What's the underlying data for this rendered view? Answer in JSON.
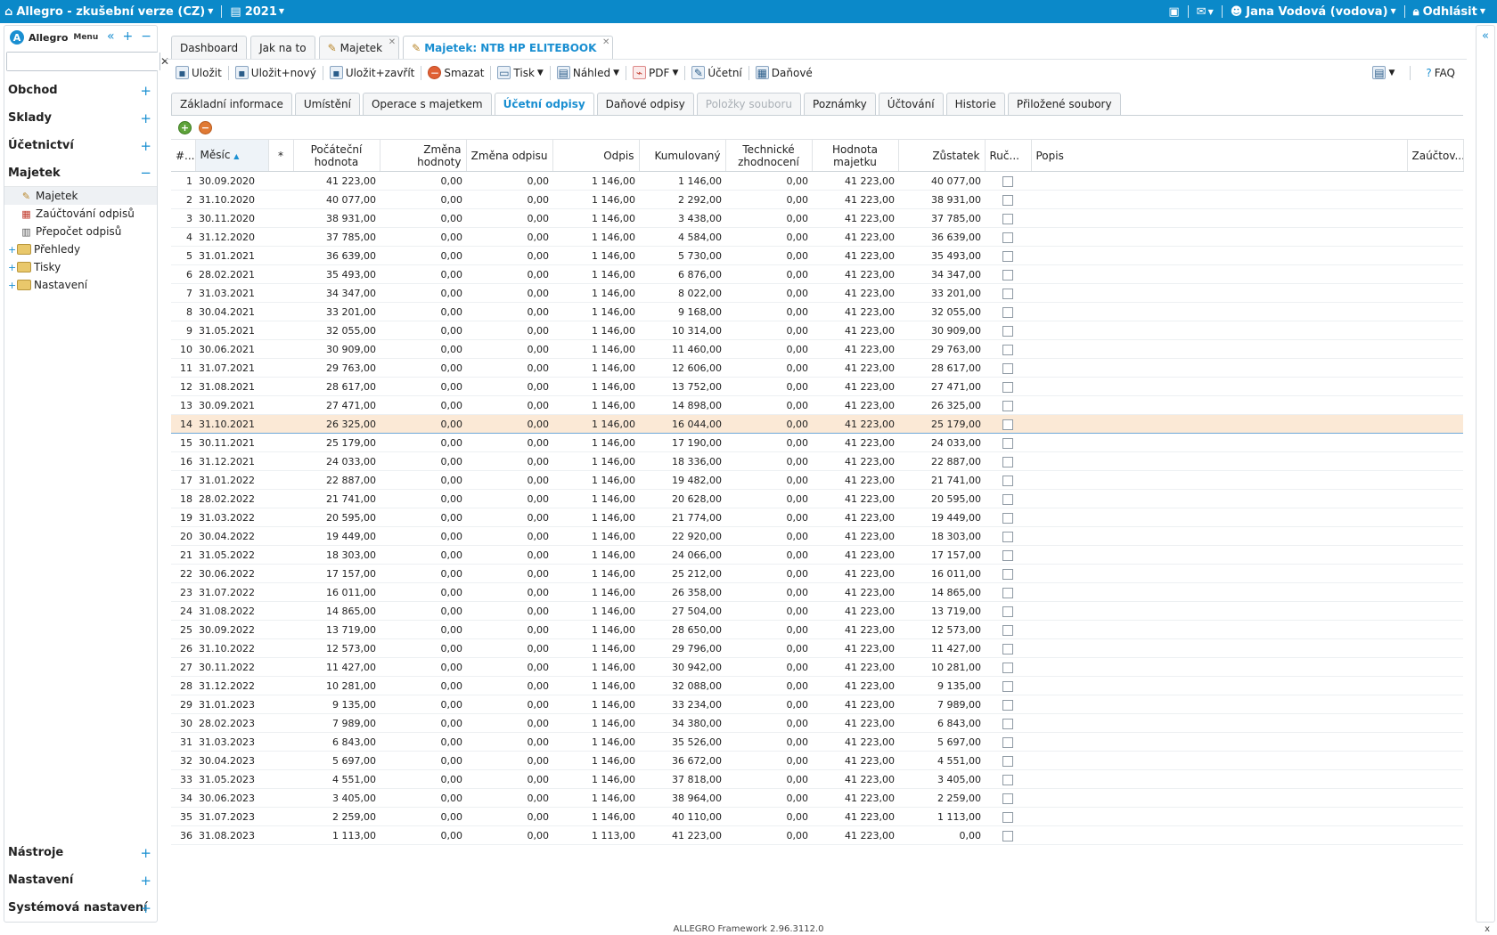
{
  "topbar": {
    "app_title": "Allegro - zkušební verze (CZ)",
    "year": "2021",
    "user": "Jana Vodová (vodova)",
    "logout": "Odhlásit"
  },
  "sidebar": {
    "brand": "Allegro",
    "menu_label": "Menu",
    "search_placeholder": "",
    "sections_top": [
      {
        "label": "Obchod"
      },
      {
        "label": "Sklady"
      },
      {
        "label": "Účetnictví"
      }
    ],
    "open_section": {
      "label": "Majetek",
      "items": [
        "Majetek",
        "Zaúčtování odpisů",
        "Přepočet odpisů"
      ],
      "folders": [
        "Přehledy",
        "Tisky",
        "Nastavení"
      ]
    },
    "sections_bottom": [
      {
        "label": "Nástroje"
      },
      {
        "label": "Nastavení"
      },
      {
        "label": "Systémová nastavení"
      }
    ]
  },
  "doc_tabs": [
    "Dashboard",
    "Jak na to",
    "Majetek",
    "Majetek: NTB HP ELITEBOOK"
  ],
  "toolbar": {
    "save": "Uložit",
    "save_new": "Uložit+nový",
    "save_close": "Uložit+zavřít",
    "delete": "Smazat",
    "print": "Tisk",
    "preview": "Náhled",
    "pdf": "PDF",
    "accounting": "Účetní",
    "tax": "Daňové",
    "faq": "FAQ"
  },
  "sub_tabs": [
    "Základní informace",
    "Umístění",
    "Operace s majetkem",
    "Účetní odpisy",
    "Daňové odpisy",
    "Položky souboru",
    "Poznámky",
    "Účtování",
    "Historie",
    "Přiložené soubory"
  ],
  "grid": {
    "columns": {
      "idx": "#...",
      "month": "Měsíc",
      "star": "*",
      "initial": "Počáteční hodnota",
      "value_change": "Změna hodnoty",
      "dep_change": "Změna odpisu",
      "dep": "Odpis",
      "cumulative": "Kumulovaný",
      "tech": "Technické zhodnocení",
      "asset_value": "Hodnota majetku",
      "residual": "Zůstatek",
      "manual": "Ruč...",
      "desc": "Popis",
      "posting": "Zaúčtov..."
    },
    "selected_row": 14,
    "rows": [
      [
        "1",
        "30.09.2020",
        "41 223,00",
        "0,00",
        "0,00",
        "1 146,00",
        "1 146,00",
        "0,00",
        "41 223,00",
        "40 077,00"
      ],
      [
        "2",
        "31.10.2020",
        "40 077,00",
        "0,00",
        "0,00",
        "1 146,00",
        "2 292,00",
        "0,00",
        "41 223,00",
        "38 931,00"
      ],
      [
        "3",
        "30.11.2020",
        "38 931,00",
        "0,00",
        "0,00",
        "1 146,00",
        "3 438,00",
        "0,00",
        "41 223,00",
        "37 785,00"
      ],
      [
        "4",
        "31.12.2020",
        "37 785,00",
        "0,00",
        "0,00",
        "1 146,00",
        "4 584,00",
        "0,00",
        "41 223,00",
        "36 639,00"
      ],
      [
        "5",
        "31.01.2021",
        "36 639,00",
        "0,00",
        "0,00",
        "1 146,00",
        "5 730,00",
        "0,00",
        "41 223,00",
        "35 493,00"
      ],
      [
        "6",
        "28.02.2021",
        "35 493,00",
        "0,00",
        "0,00",
        "1 146,00",
        "6 876,00",
        "0,00",
        "41 223,00",
        "34 347,00"
      ],
      [
        "7",
        "31.03.2021",
        "34 347,00",
        "0,00",
        "0,00",
        "1 146,00",
        "8 022,00",
        "0,00",
        "41 223,00",
        "33 201,00"
      ],
      [
        "8",
        "30.04.2021",
        "33 201,00",
        "0,00",
        "0,00",
        "1 146,00",
        "9 168,00",
        "0,00",
        "41 223,00",
        "32 055,00"
      ],
      [
        "9",
        "31.05.2021",
        "32 055,00",
        "0,00",
        "0,00",
        "1 146,00",
        "10 314,00",
        "0,00",
        "41 223,00",
        "30 909,00"
      ],
      [
        "10",
        "30.06.2021",
        "30 909,00",
        "0,00",
        "0,00",
        "1 146,00",
        "11 460,00",
        "0,00",
        "41 223,00",
        "29 763,00"
      ],
      [
        "11",
        "31.07.2021",
        "29 763,00",
        "0,00",
        "0,00",
        "1 146,00",
        "12 606,00",
        "0,00",
        "41 223,00",
        "28 617,00"
      ],
      [
        "12",
        "31.08.2021",
        "28 617,00",
        "0,00",
        "0,00",
        "1 146,00",
        "13 752,00",
        "0,00",
        "41 223,00",
        "27 471,00"
      ],
      [
        "13",
        "30.09.2021",
        "27 471,00",
        "0,00",
        "0,00",
        "1 146,00",
        "14 898,00",
        "0,00",
        "41 223,00",
        "26 325,00"
      ],
      [
        "14",
        "31.10.2021",
        "26 325,00",
        "0,00",
        "0,00",
        "1 146,00",
        "16 044,00",
        "0,00",
        "41 223,00",
        "25 179,00"
      ],
      [
        "15",
        "30.11.2021",
        "25 179,00",
        "0,00",
        "0,00",
        "1 146,00",
        "17 190,00",
        "0,00",
        "41 223,00",
        "24 033,00"
      ],
      [
        "16",
        "31.12.2021",
        "24 033,00",
        "0,00",
        "0,00",
        "1 146,00",
        "18 336,00",
        "0,00",
        "41 223,00",
        "22 887,00"
      ],
      [
        "17",
        "31.01.2022",
        "22 887,00",
        "0,00",
        "0,00",
        "1 146,00",
        "19 482,00",
        "0,00",
        "41 223,00",
        "21 741,00"
      ],
      [
        "18",
        "28.02.2022",
        "21 741,00",
        "0,00",
        "0,00",
        "1 146,00",
        "20 628,00",
        "0,00",
        "41 223,00",
        "20 595,00"
      ],
      [
        "19",
        "31.03.2022",
        "20 595,00",
        "0,00",
        "0,00",
        "1 146,00",
        "21 774,00",
        "0,00",
        "41 223,00",
        "19 449,00"
      ],
      [
        "20",
        "30.04.2022",
        "19 449,00",
        "0,00",
        "0,00",
        "1 146,00",
        "22 920,00",
        "0,00",
        "41 223,00",
        "18 303,00"
      ],
      [
        "21",
        "31.05.2022",
        "18 303,00",
        "0,00",
        "0,00",
        "1 146,00",
        "24 066,00",
        "0,00",
        "41 223,00",
        "17 157,00"
      ],
      [
        "22",
        "30.06.2022",
        "17 157,00",
        "0,00",
        "0,00",
        "1 146,00",
        "25 212,00",
        "0,00",
        "41 223,00",
        "16 011,00"
      ],
      [
        "23",
        "31.07.2022",
        "16 011,00",
        "0,00",
        "0,00",
        "1 146,00",
        "26 358,00",
        "0,00",
        "41 223,00",
        "14 865,00"
      ],
      [
        "24",
        "31.08.2022",
        "14 865,00",
        "0,00",
        "0,00",
        "1 146,00",
        "27 504,00",
        "0,00",
        "41 223,00",
        "13 719,00"
      ],
      [
        "25",
        "30.09.2022",
        "13 719,00",
        "0,00",
        "0,00",
        "1 146,00",
        "28 650,00",
        "0,00",
        "41 223,00",
        "12 573,00"
      ],
      [
        "26",
        "31.10.2022",
        "12 573,00",
        "0,00",
        "0,00",
        "1 146,00",
        "29 796,00",
        "0,00",
        "41 223,00",
        "11 427,00"
      ],
      [
        "27",
        "30.11.2022",
        "11 427,00",
        "0,00",
        "0,00",
        "1 146,00",
        "30 942,00",
        "0,00",
        "41 223,00",
        "10 281,00"
      ],
      [
        "28",
        "31.12.2022",
        "10 281,00",
        "0,00",
        "0,00",
        "1 146,00",
        "32 088,00",
        "0,00",
        "41 223,00",
        "9 135,00"
      ],
      [
        "29",
        "31.01.2023",
        "9 135,00",
        "0,00",
        "0,00",
        "1 146,00",
        "33 234,00",
        "0,00",
        "41 223,00",
        "7 989,00"
      ],
      [
        "30",
        "28.02.2023",
        "7 989,00",
        "0,00",
        "0,00",
        "1 146,00",
        "34 380,00",
        "0,00",
        "41 223,00",
        "6 843,00"
      ],
      [
        "31",
        "31.03.2023",
        "6 843,00",
        "0,00",
        "0,00",
        "1 146,00",
        "35 526,00",
        "0,00",
        "41 223,00",
        "5 697,00"
      ],
      [
        "32",
        "30.04.2023",
        "5 697,00",
        "0,00",
        "0,00",
        "1 146,00",
        "36 672,00",
        "0,00",
        "41 223,00",
        "4 551,00"
      ],
      [
        "33",
        "31.05.2023",
        "4 551,00",
        "0,00",
        "0,00",
        "1 146,00",
        "37 818,00",
        "0,00",
        "41 223,00",
        "3 405,00"
      ],
      [
        "34",
        "30.06.2023",
        "3 405,00",
        "0,00",
        "0,00",
        "1 146,00",
        "38 964,00",
        "0,00",
        "41 223,00",
        "2 259,00"
      ],
      [
        "35",
        "31.07.2023",
        "2 259,00",
        "0,00",
        "0,00",
        "1 146,00",
        "40 110,00",
        "0,00",
        "41 223,00",
        "1 113,00"
      ],
      [
        "36",
        "31.08.2023",
        "1 113,00",
        "0,00",
        "0,00",
        "1 113,00",
        "41 223,00",
        "0,00",
        "41 223,00",
        "0,00"
      ]
    ]
  },
  "footer": {
    "version": "ALLEGRO Framework 2.96.3112.0",
    "close": "x"
  },
  "icons": {
    "home": "home-icon",
    "calendar": "calendar-icon",
    "mail": "mail-icon",
    "user": "user-icon",
    "lock": "lock-icon",
    "save": "save-icon"
  },
  "colors": {
    "accent": "#1a8fd1",
    "topbar": "#0b89c9",
    "selected_row": "#fbe9d6"
  }
}
